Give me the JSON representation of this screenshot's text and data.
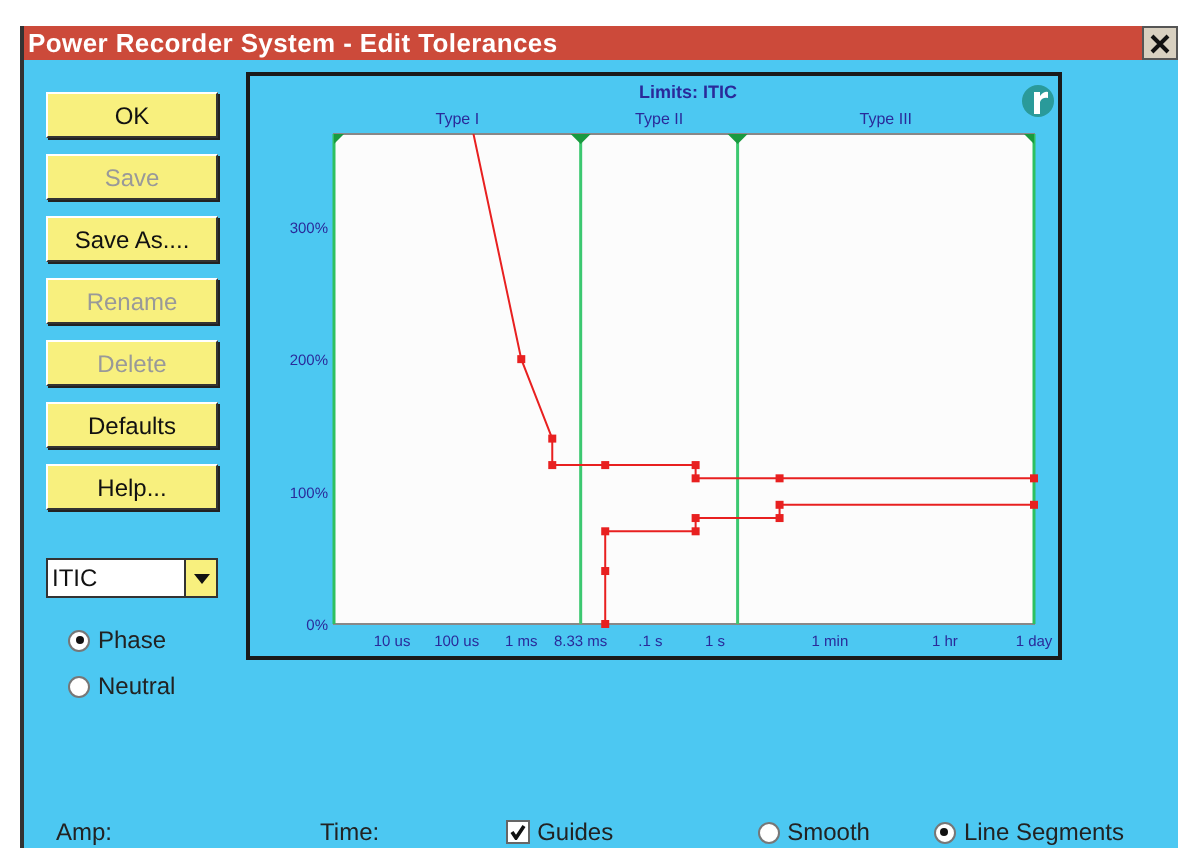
{
  "window": {
    "title": "Power Recorder System - Edit Tolerances"
  },
  "buttons": [
    {
      "label": "OK",
      "disabled": false
    },
    {
      "label": "Save",
      "disabled": true
    },
    {
      "label": "Save As....",
      "disabled": false
    },
    {
      "label": "Rename",
      "disabled": true
    },
    {
      "label": "Delete",
      "disabled": true
    },
    {
      "label": "Defaults",
      "disabled": false
    },
    {
      "label": "Help...",
      "disabled": false
    }
  ],
  "dropdown": {
    "value": "ITIC"
  },
  "mode_radios": [
    {
      "label": "Phase",
      "selected": true
    },
    {
      "label": "Neutral",
      "selected": false
    }
  ],
  "chart": {
    "title": "Limits: ITIC",
    "region_labels": [
      "Type I",
      "Type II",
      "Type III"
    ],
    "y_labels": [
      "300%",
      "200%",
      "100%",
      "0%"
    ],
    "x_labels": [
      "10 us",
      "100 us",
      "1 ms",
      "8.33 ms",
      ".1 s",
      "1 s",
      "1 min",
      "1 hr",
      "1 day"
    ]
  },
  "bottom_bar": {
    "amp_label": "Amp:",
    "time_label": "Time:",
    "guides": {
      "label": "Guides",
      "checked": true
    },
    "style_radios": [
      {
        "kind": "smooth",
        "label": "Smooth",
        "selected": false
      },
      {
        "kind": "segments",
        "label": "Line Segments",
        "selected": true
      }
    ]
  }
}
